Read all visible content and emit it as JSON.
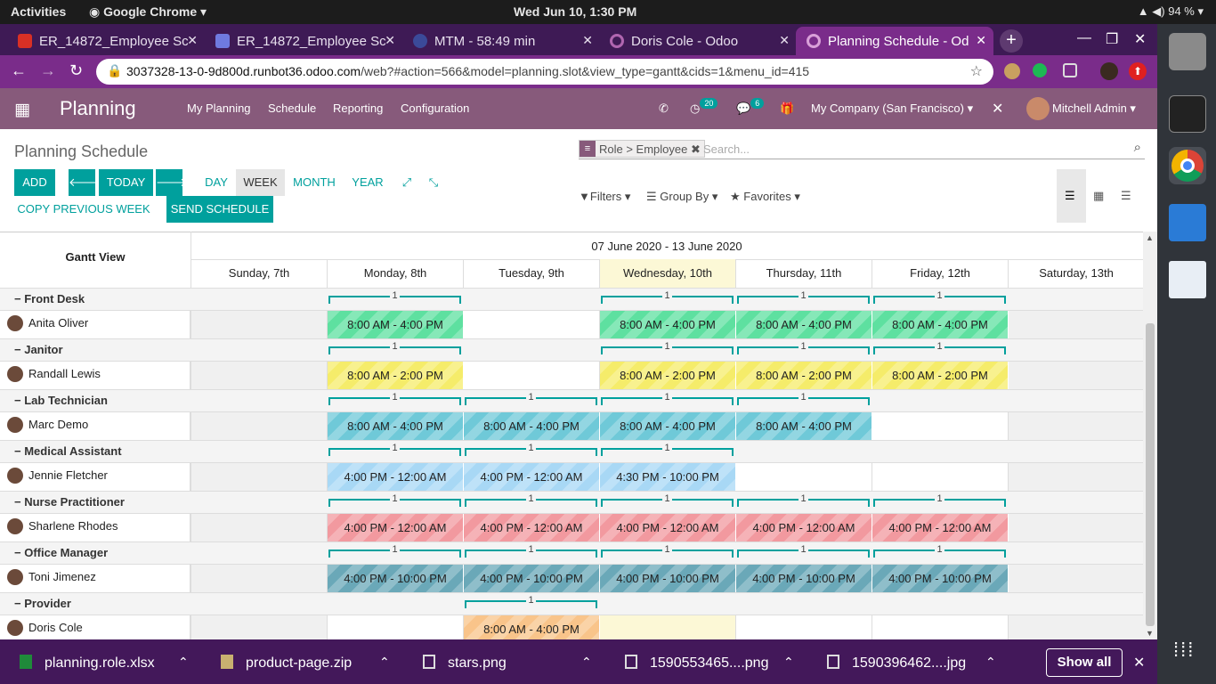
{
  "os": {
    "activities": "Activities",
    "app_name": "Google Chrome",
    "clock": "Wed Jun 10,  1:30 PM",
    "battery": "94 %"
  },
  "browser": {
    "tabs": [
      {
        "title": "ER_14872_Employee Sc",
        "color": "#d93025"
      },
      {
        "title": "ER_14872_Employee Sc",
        "color": "#6f7adf"
      },
      {
        "title": "MTM - 58:49 min",
        "color": "#3b4a99"
      },
      {
        "title": "Doris Cole - Odoo",
        "color": "#b066b0"
      },
      {
        "title": "Planning Schedule - Od",
        "color": "#b066b0"
      }
    ],
    "url_host": "3037328-13-0-9d800d.runbot36.odoo.com",
    "url_path": "/web?#action=566&model=planning.slot&view_type=gantt&cids=1&menu_id=415"
  },
  "odoo": {
    "app": "Planning",
    "menus": [
      "My Planning",
      "Schedule",
      "Reporting",
      "Configuration"
    ],
    "activity_count": "20",
    "message_count": "6",
    "company": "My Company (San Francisco)",
    "user": "Mitchell Admin"
  },
  "cp": {
    "title": "Planning Schedule",
    "facet": "Role > Employee",
    "search_placeholder": "Search...",
    "add": "ADD",
    "today": "TODAY",
    "day": "DAY",
    "week": "WEEK",
    "month": "MONTH",
    "year": "YEAR",
    "copy": "COPY PREVIOUS WEEK",
    "send": "SEND SCHEDULE",
    "filters": "Filters",
    "groupby": "Group By",
    "favorites": "Favorites"
  },
  "gantt": {
    "corner": "Gantt View",
    "range": "07 June 2020 - 13 June 2020",
    "days": [
      "Sunday, 7th",
      "Monday, 8th",
      "Tuesday, 9th",
      "Wednesday, 10th",
      "Thursday, 11th",
      "Friday, 12th",
      "Saturday, 13th"
    ],
    "groups": [
      {
        "role": "Front Desk",
        "employee": "Anita Oliver",
        "color": "#5ee0a0",
        "slots": [
          [
            1,
            "8:00 AM - 4:00 PM"
          ],
          [
            3,
            "8:00 AM - 4:00 PM"
          ],
          [
            4,
            "8:00 AM - 4:00 PM"
          ],
          [
            5,
            "8:00 AM - 4:00 PM"
          ]
        ]
      },
      {
        "role": "Janitor",
        "employee": "Randall Lewis",
        "color": "#f5ec6a",
        "slots": [
          [
            1,
            "8:00 AM - 2:00 PM"
          ],
          [
            3,
            "8:00 AM - 2:00 PM"
          ],
          [
            4,
            "8:00 AM - 2:00 PM"
          ],
          [
            5,
            "8:00 AM - 2:00 PM"
          ]
        ]
      },
      {
        "role": "Lab Technician",
        "employee": "Marc Demo",
        "color": "#6fc9d8",
        "slots": [
          [
            1,
            "8:00 AM - 4:00 PM"
          ],
          [
            2,
            "8:00 AM - 4:00 PM"
          ],
          [
            3,
            "8:00 AM - 4:00 PM"
          ],
          [
            4,
            "8:00 AM - 4:00 PM"
          ]
        ]
      },
      {
        "role": "Medical Assistant",
        "employee": "Jennie Fletcher",
        "color": "#a8d8f5",
        "slots": [
          [
            1,
            "4:00 PM - 12:00 AM"
          ],
          [
            2,
            "4:00 PM - 12:00 AM"
          ],
          [
            3,
            "4:30 PM - 10:00 PM"
          ]
        ]
      },
      {
        "role": "Nurse Practitioner",
        "employee": "Sharlene Rhodes",
        "color": "#f2999f",
        "slots": [
          [
            1,
            "4:00 PM - 12:00 AM"
          ],
          [
            2,
            "4:00 PM - 12:00 AM"
          ],
          [
            3,
            "4:00 PM - 12:00 AM"
          ],
          [
            4,
            "4:00 PM - 12:00 AM"
          ],
          [
            5,
            "4:00 PM - 12:00 AM"
          ]
        ]
      },
      {
        "role": "Office Manager",
        "employee": "Toni Jimenez",
        "color": "#6aa8b8",
        "slots": [
          [
            1,
            "4:00 PM - 10:00 PM"
          ],
          [
            2,
            "4:00 PM - 10:00 PM"
          ],
          [
            3,
            "4:00 PM - 10:00 PM"
          ],
          [
            4,
            "4:00 PM - 10:00 PM"
          ],
          [
            5,
            "4:00 PM - 10:00 PM"
          ]
        ]
      },
      {
        "role": "Provider",
        "employee": "Doris Cole",
        "color": "#f9c48a",
        "slots": [
          [
            2,
            "8:00 AM - 4:00 PM"
          ]
        ]
      }
    ],
    "count_label": "1"
  },
  "downloads": {
    "items": [
      "planning.role.xlsx",
      "product-page.zip",
      "stars.png",
      "1590553465....png",
      "1590396462....jpg"
    ],
    "show_all": "Show all"
  }
}
